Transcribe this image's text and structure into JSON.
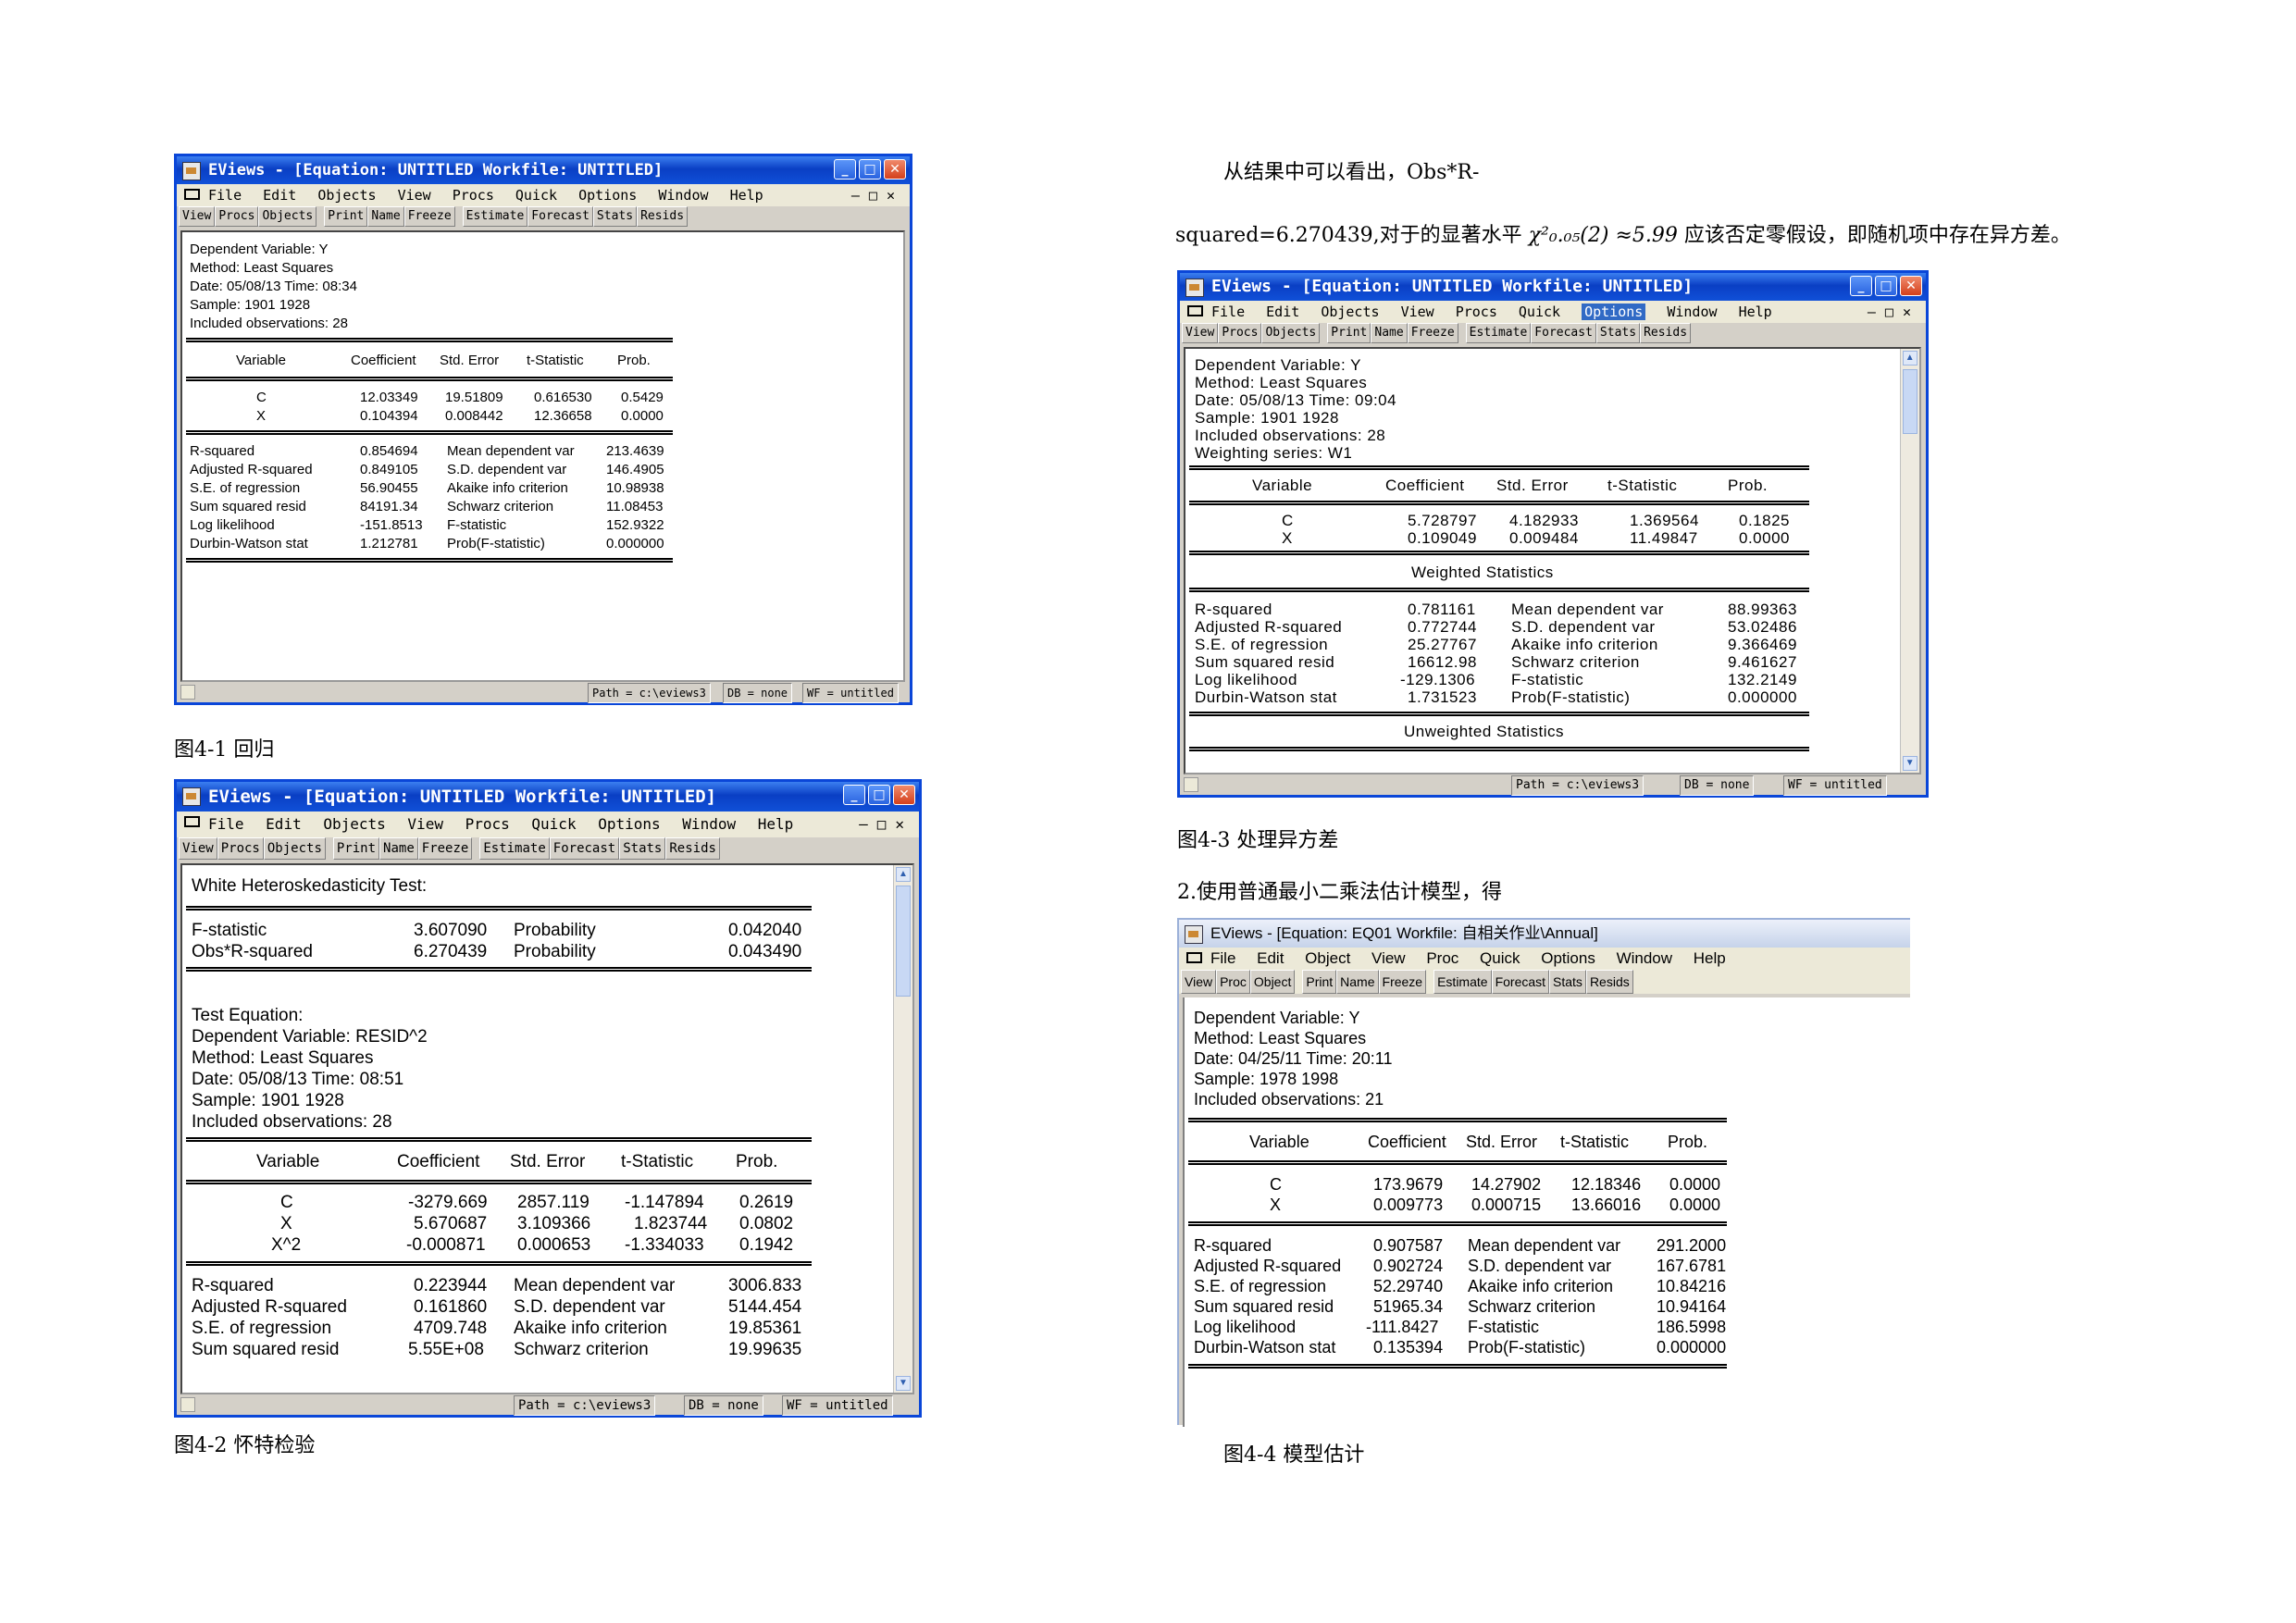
{
  "text": {
    "p1_line1": "从结果中可以看出，Obs*R-",
    "p1_line2_a": "squared=6.270439,对于的显著水平",
    "p1_line2_formula": "χ²₀.₀₅(2) ≈5.99",
    "p1_line2_b": "应该否定零假设，即随机项中存在异方差。",
    "p2": "2.使用普通最小二乘法估计模型，得"
  },
  "captions": {
    "fig1": "图4-1  回归",
    "fig2": "图4-2  怀特检验",
    "fig3": "图4-3  处理异方差",
    "fig4": "图4-4  模型估计"
  },
  "common": {
    "menu": [
      "File",
      "Edit",
      "Objects",
      "View",
      "Procs",
      "Quick",
      "Options",
      "Window",
      "Help"
    ],
    "toolbar_a": [
      "View",
      "Procs",
      "Objects"
    ],
    "toolbar_b": [
      "Print",
      "Name",
      "Freeze"
    ],
    "toolbar_c": [
      "Estimate",
      "Forecast",
      "Stats",
      "Resids"
    ],
    "status_path": "Path = c:\\eviews3",
    "status_db": "DB = none",
    "status_wf": "WF = untitled",
    "hdr_variable": "Variable",
    "hdr_coef": "Coefficient",
    "hdr_se": "Std. Error",
    "hdr_t": "t-Statistic",
    "hdr_prob": "Prob."
  },
  "fig1": {
    "title": "EViews - [Equation: UNTITLED    Workfile: UNTITLED]",
    "header": [
      "Dependent Variable: Y",
      "Method: Least Squares",
      "Date: 05/08/13   Time: 08:34",
      "Sample: 1901 1928",
      "Included observations: 28"
    ],
    "rows": [
      [
        "C",
        "12.03349",
        "19.51809",
        "0.616530",
        "0.5429"
      ],
      [
        "X",
        "0.104394",
        "0.008442",
        "12.36658",
        "0.0000"
      ]
    ],
    "stats": [
      [
        "R-squared",
        "0.854694",
        "Mean dependent var",
        "213.4639"
      ],
      [
        "Adjusted R-squared",
        "0.849105",
        "S.D. dependent var",
        "146.4905"
      ],
      [
        "S.E. of regression",
        "56.90455",
        "Akaike info criterion",
        "10.98938"
      ],
      [
        "Sum squared resid",
        "84191.34",
        "Schwarz criterion",
        "11.08453"
      ],
      [
        "Log likelihood",
        "-151.8513",
        "F-statistic",
        "152.9322"
      ],
      [
        "Durbin-Watson stat",
        "1.212781",
        "Prob(F-statistic)",
        "0.000000"
      ]
    ]
  },
  "fig2": {
    "title": "EViews - [Equation: UNTITLED    Workfile: UNTITLED]",
    "test_title": "White Heteroskedasticity Test:",
    "test_rows": [
      [
        "F-statistic",
        "3.607090",
        "Probability",
        "0.042040"
      ],
      [
        "Obs*R-squared",
        "6.270439",
        "Probability",
        "0.043490"
      ]
    ],
    "header": [
      "Test Equation:",
      "Dependent Variable: RESID^2",
      "Method: Least Squares",
      "Date: 05/08/13   Time: 08:51",
      "Sample: 1901 1928",
      "Included observations: 28"
    ],
    "rows": [
      [
        "C",
        "-3279.669",
        "2857.119",
        "-1.147894",
        "0.2619"
      ],
      [
        "X",
        "5.670687",
        "3.109366",
        "1.823744",
        "0.0802"
      ],
      [
        "X^2",
        "-0.000871",
        "0.000653",
        "-1.334033",
        "0.1942"
      ]
    ],
    "stats": [
      [
        "R-squared",
        "0.223944",
        "Mean dependent var",
        "3006.833"
      ],
      [
        "Adjusted R-squared",
        "0.161860",
        "S.D. dependent var",
        "5144.454"
      ],
      [
        "S.E. of regression",
        "4709.748",
        "Akaike info criterion",
        "19.85361"
      ],
      [
        "Sum squared resid",
        "5.55E+08",
        "Schwarz criterion",
        "19.99635"
      ]
    ]
  },
  "fig3": {
    "title": "EViews - [Equation: UNTITLED    Workfile: UNTITLED]",
    "header": [
      "Dependent Variable: Y",
      "Method: Least Squares",
      "Date: 05/08/13   Time: 09:04",
      "Sample: 1901 1928",
      "Included observations: 28",
      "Weighting series: W1"
    ],
    "rows": [
      [
        "C",
        "5.728797",
        "4.182933",
        "1.369564",
        "0.1825"
      ],
      [
        "X",
        "0.109049",
        "0.009484",
        "11.49847",
        "0.0000"
      ]
    ],
    "weighted_title": "Weighted Statistics",
    "stats": [
      [
        "R-squared",
        "0.781161",
        "Mean dependent var",
        "88.99363"
      ],
      [
        "Adjusted R-squared",
        "0.772744",
        "S.D. dependent var",
        "53.02486"
      ],
      [
        "S.E. of regression",
        "25.27767",
        "Akaike info criterion",
        "9.366469"
      ],
      [
        "Sum squared resid",
        "16612.98",
        "Schwarz criterion",
        "9.461627"
      ],
      [
        "Log likelihood",
        "-129.1306",
        "F-statistic",
        "132.2149"
      ],
      [
        "Durbin-Watson stat",
        "1.731523",
        "Prob(F-statistic)",
        "0.000000"
      ]
    ],
    "unweighted_title": "Unweighted Statistics"
  },
  "fig4": {
    "title": "EViews - [Equation: EQ01   Workfile: 自相关作业\\Annual]",
    "menu": [
      "File",
      "Edit",
      "Object",
      "View",
      "Proc",
      "Quick",
      "Options",
      "Window",
      "Help"
    ],
    "toolbar_a": [
      "View",
      "Proc",
      "Object"
    ],
    "header": [
      "Dependent Variable: Y",
      "Method: Least Squares",
      "Date: 04/25/11   Time: 20:11",
      "Sample: 1978 1998",
      "Included observations: 21"
    ],
    "rows": [
      [
        "C",
        "173.9679",
        "14.27902",
        "12.18346",
        "0.0000"
      ],
      [
        "X",
        "0.009773",
        "0.000715",
        "13.66016",
        "0.0000"
      ]
    ],
    "stats": [
      [
        "R-squared",
        "0.907587",
        "Mean dependent var",
        "291.2000"
      ],
      [
        "Adjusted R-squared",
        "0.902724",
        "S.D. dependent var",
        "167.6781"
      ],
      [
        "S.E. of regression",
        "52.29740",
        "Akaike info criterion",
        "10.84216"
      ],
      [
        "Sum squared resid",
        "51965.34",
        "Schwarz criterion",
        "10.94164"
      ],
      [
        "Log likelihood",
        "-111.8427",
        "F-statistic",
        "186.5998"
      ],
      [
        "Durbin-Watson stat",
        "0.135394",
        "Prob(F-statistic)",
        "0.000000"
      ]
    ]
  }
}
